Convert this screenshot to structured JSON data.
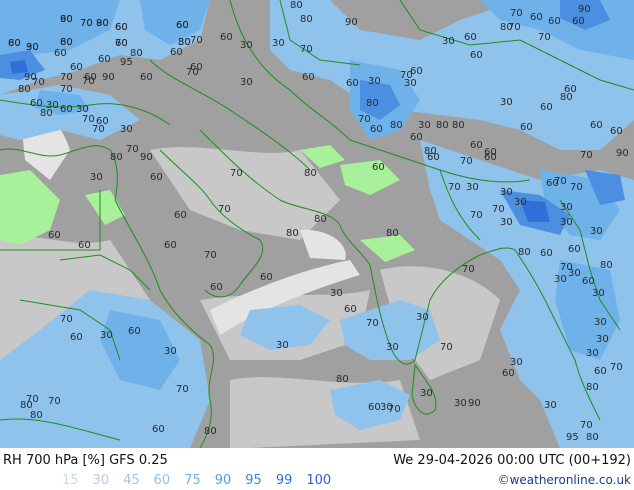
{
  "title": "RH 700 hPa [%] GFS 0.25",
  "valid_time": "We 29-04-2026 00:00 UTC (00+192)",
  "credit": "©weatheronline.co.uk",
  "legend": [
    {
      "label": "15",
      "color": "#c8dbe6"
    },
    {
      "label": "30",
      "color": "#b8cfe0"
    },
    {
      "label": "45",
      "color": "#a9c7de"
    },
    {
      "label": "60",
      "color": "#8fc3ec"
    },
    {
      "label": "75",
      "color": "#6db5ea"
    },
    {
      "label": "90",
      "color": "#4f9ee6"
    },
    {
      "label": "95",
      "color": "#3f86e0"
    },
    {
      "label": "99",
      "color": "#2f6fd8"
    },
    {
      "label": "100",
      "color": "#2a5fd0"
    }
  ],
  "colors": {
    "dry": "#9a9a9a",
    "mid_dry": "#c4c4c4",
    "very_dry": "#e6e6e6",
    "moist_60": "#8fc3ec",
    "moist_75": "#6fb2ea",
    "moist_90": "#4c8fe0",
    "moist_95": "#2f6fd8",
    "green_zone": "#a8f09a",
    "coast": "#1e8c1e",
    "contour_label": "#2b2b2b"
  },
  "contour_labels": [
    "90",
    "70",
    "80",
    "60",
    "60",
    "60",
    "70",
    "80",
    "80",
    "90",
    "60",
    "70",
    "80",
    "60",
    "80",
    "80",
    "90",
    "70",
    "60",
    "60",
    "60",
    "90",
    "80",
    "70",
    "60",
    "70",
    "60",
    "30",
    "30",
    "70",
    "60",
    "70",
    "60",
    "60",
    "95",
    "90",
    "60",
    "70",
    "70",
    "60",
    "30",
    "60",
    "90",
    "70",
    "80",
    "70",
    "30",
    "30",
    "60",
    "60",
    "30",
    "60",
    "30",
    "80",
    "80",
    "30",
    "60",
    "70",
    "80",
    "80",
    "60",
    "60",
    "70",
    "60",
    "60",
    "70",
    "70",
    "70",
    "30",
    "30",
    "70",
    "30",
    "60",
    "30",
    "70",
    "60",
    "70",
    "30",
    "80",
    "60",
    "70",
    "80",
    "90",
    "30",
    "60",
    "70",
    "80",
    "60",
    "80",
    "60",
    "60",
    "30",
    "60",
    "80",
    "60",
    "60",
    "60",
    "70",
    "90",
    "70",
    "70",
    "60",
    "30",
    "70",
    "30",
    "80",
    "60",
    "30",
    "30",
    "30",
    "30",
    "70",
    "60",
    "80",
    "70",
    "80",
    "95",
    "30",
    "30",
    "60",
    "80",
    "60",
    "30",
    "30",
    "30",
    "70",
    "30",
    "60",
    "90",
    "30",
    "30",
    "30",
    "70",
    "60",
    "80",
    "30",
    "30",
    "70",
    "60",
    "30",
    "30",
    "60",
    "60",
    "70",
    "60",
    "70",
    "80",
    "80",
    "80",
    "70",
    "60",
    "60",
    "60",
    "70",
    "30",
    "60",
    "30",
    "70",
    "80",
    "60",
    "70",
    "80",
    "80",
    "70",
    "60",
    "60",
    "70",
    "90",
    "60",
    "60",
    "80",
    "60",
    "30",
    "60",
    "30"
  ]
}
